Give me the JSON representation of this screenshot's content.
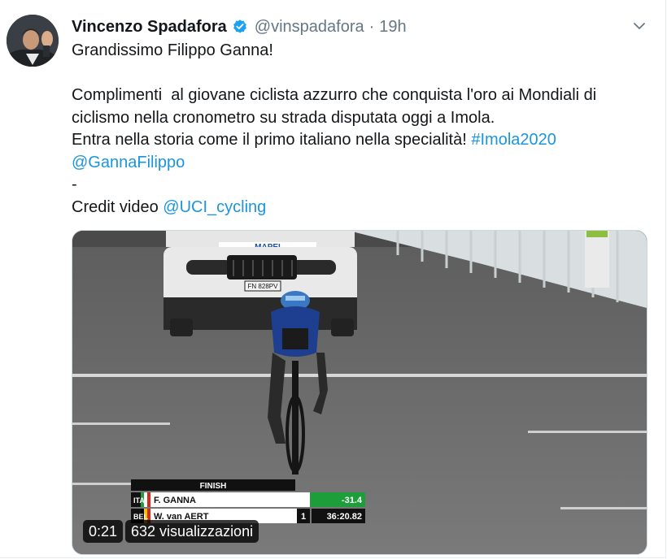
{
  "tweet": {
    "name": "Vincenzo Spadafora",
    "handle": "@vinspadafora",
    "separator": "·",
    "time": "19h",
    "lines": [
      [
        {
          "text": "Grandissimo Filippo Ganna!",
          "link": false
        }
      ],
      [
        {
          "text": "",
          "link": false
        }
      ],
      [
        {
          "text": "Complimenti  al giovane ciclista azzurro che conquista l'oro ai Mondiali di",
          "link": false
        }
      ],
      [
        {
          "text": "ciclismo nella cronometro su strada disputata oggi a Imola.",
          "link": false
        }
      ],
      [
        {
          "text": "Entra nella storia come il primo italiano nella specialità! ",
          "link": false
        },
        {
          "text": "#Imola2020",
          "link": true
        }
      ],
      [
        {
          "text": "@GannaFilippo",
          "link": true
        }
      ],
      [
        {
          "text": "-",
          "link": false
        }
      ],
      [
        {
          "text": "Credit video ",
          "link": false
        },
        {
          "text": "@UCI_cycling",
          "link": true
        }
      ]
    ]
  },
  "video": {
    "car_banner": "MAPEI",
    "car_plate": "FN 828PV",
    "scoreboard": {
      "title": "FINISH",
      "rows": [
        {
          "country": "ITA",
          "rider": "F. GANNA",
          "rank": "",
          "result": "-31.4"
        },
        {
          "country": "BEL",
          "rider": "W. van AERT",
          "rank": "1",
          "result": "36:20.82"
        }
      ]
    },
    "elapsed": "0:21",
    "views": "632 visualizzazioni"
  },
  "colors": {
    "link": "#1b95e0",
    "verified": "#1da1f2",
    "secondary": "#657786",
    "result_green": "#1e9e3a"
  },
  "icons": [
    "verified-badge-icon",
    "chevron-down-icon"
  ]
}
